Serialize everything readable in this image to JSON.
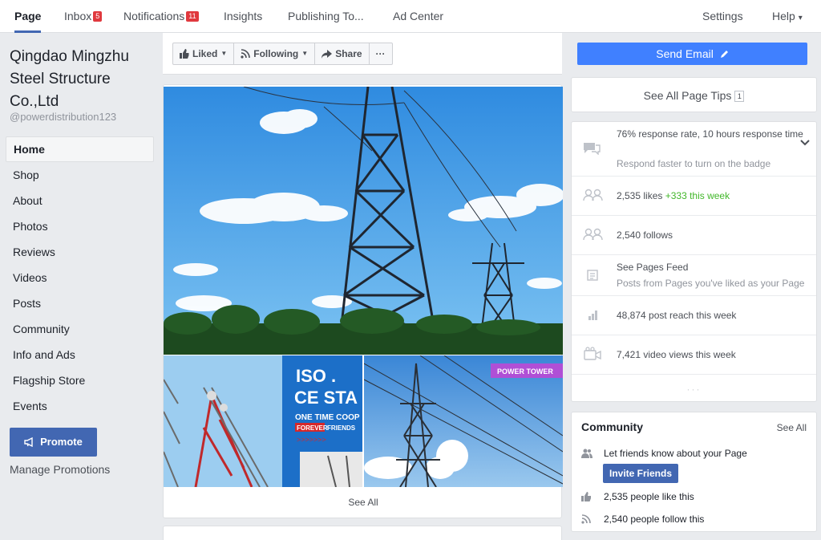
{
  "topnav": {
    "tabs": [
      {
        "label": "Page"
      },
      {
        "label": "Inbox",
        "badge": "5"
      },
      {
        "label": "Notifications",
        "badge": "11"
      },
      {
        "label": "Insights"
      },
      {
        "label": "Publishing To..."
      },
      {
        "label": "Ad Center"
      }
    ],
    "settings_label": "Settings",
    "help_label": "Help",
    "help_caret": "▾"
  },
  "sidebar": {
    "page_name": "Qingdao Mingzhu Steel Structure Co.,Ltd",
    "handle": "@powerdistribution123",
    "items": [
      {
        "label": "Home"
      },
      {
        "label": "Shop"
      },
      {
        "label": "About"
      },
      {
        "label": "Photos"
      },
      {
        "label": "Reviews"
      },
      {
        "label": "Videos"
      },
      {
        "label": "Posts"
      },
      {
        "label": "Community"
      },
      {
        "label": "Info and Ads"
      },
      {
        "label": "Flagship Store"
      },
      {
        "label": "Events"
      }
    ],
    "promote_label": "Promote",
    "manage_promotions": "Manage Promotions"
  },
  "actions": {
    "liked": "Liked",
    "following": "Following",
    "share": "Share",
    "more": "···"
  },
  "photos": {
    "overlay_iso": "ISO .",
    "overlay_ce": "CE STA",
    "overlay_one_time": "ONE TIME COOP",
    "overlay_forever": "FOREVER",
    "overlay_friends": "FRIENDS",
    "overlay_power_tower": "POWER TOWER",
    "see_all": "See All"
  },
  "right": {
    "send_email": "Send Email",
    "see_all_tips": "See All Page Tips",
    "tips_count": "1",
    "response_rate": "76% response rate, 10 hours response time",
    "response_sub": "Respond faster to turn on the badge",
    "likes": "2,535 likes",
    "likes_week": "+333 this week",
    "follows": "2,540 follows",
    "pages_feed": "See Pages Feed",
    "pages_feed_sub": "Posts from Pages you've liked as your Page",
    "post_reach": "48,874 post reach this week",
    "video_views": "7,421 video views this week",
    "dots": "···"
  },
  "community": {
    "title": "Community",
    "see_all": "See All",
    "invite_text": "Let friends know about your Page",
    "invite_button": "Invite Friends",
    "people_like": "2,535 people like this",
    "people_follow": "2,540 people follow this"
  },
  "colors": {
    "brand_blue": "#4267b2",
    "send_email_blue": "#4080ff",
    "badge_red": "#e0393e",
    "positive_green": "#42b72a"
  }
}
